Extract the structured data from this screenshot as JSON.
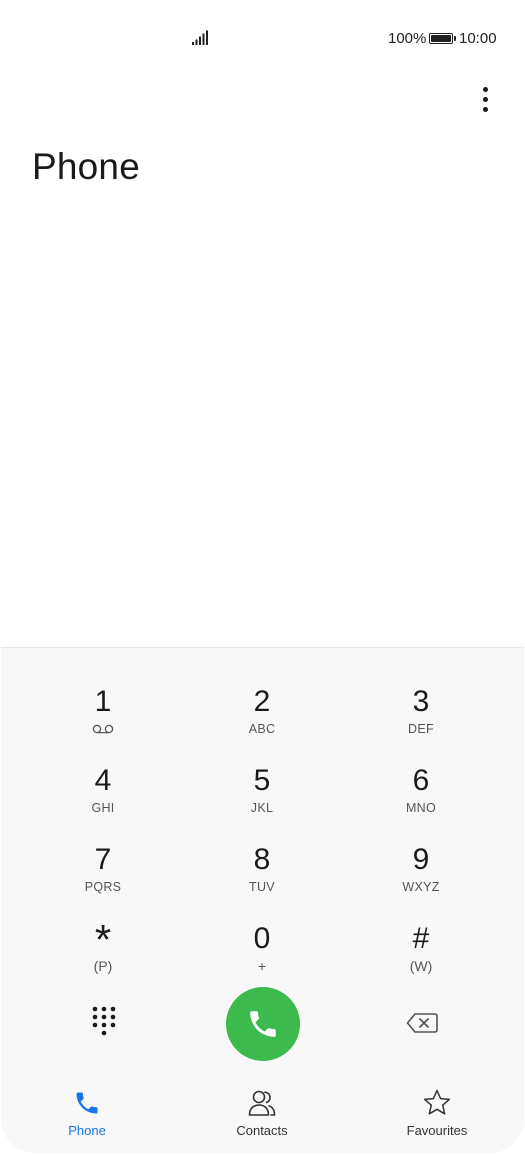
{
  "status_bar": {
    "battery_percent": "100%",
    "time": "10:00",
    "signal_icon": "signal-icon",
    "battery_icon": "battery-icon"
  },
  "header": {
    "title": "Phone",
    "more_icon": "more-vertical-icon"
  },
  "dialpad": {
    "keys": [
      {
        "digit": "1",
        "sub": "",
        "sub_icon": "voicemail-icon"
      },
      {
        "digit": "2",
        "sub": "ABC"
      },
      {
        "digit": "3",
        "sub": "DEF"
      },
      {
        "digit": "4",
        "sub": "GHI"
      },
      {
        "digit": "5",
        "sub": "JKL"
      },
      {
        "digit": "6",
        "sub": "MNO"
      },
      {
        "digit": "7",
        "sub": "PQRS"
      },
      {
        "digit": "8",
        "sub": "TUV"
      },
      {
        "digit": "9",
        "sub": "WXYZ"
      },
      {
        "digit": "*",
        "sub": "(P)"
      },
      {
        "digit": "0",
        "sub": "+"
      },
      {
        "digit": "#",
        "sub": "(W)"
      }
    ],
    "call_color": "#3dba4e"
  },
  "bottom_nav": {
    "items": [
      {
        "label": "Phone",
        "icon": "phone-icon",
        "active": true
      },
      {
        "label": "Contacts",
        "icon": "contacts-icon",
        "active": false
      },
      {
        "label": "Favourites",
        "icon": "star-icon",
        "active": false
      }
    ],
    "accent_color": "#1b73e8"
  }
}
